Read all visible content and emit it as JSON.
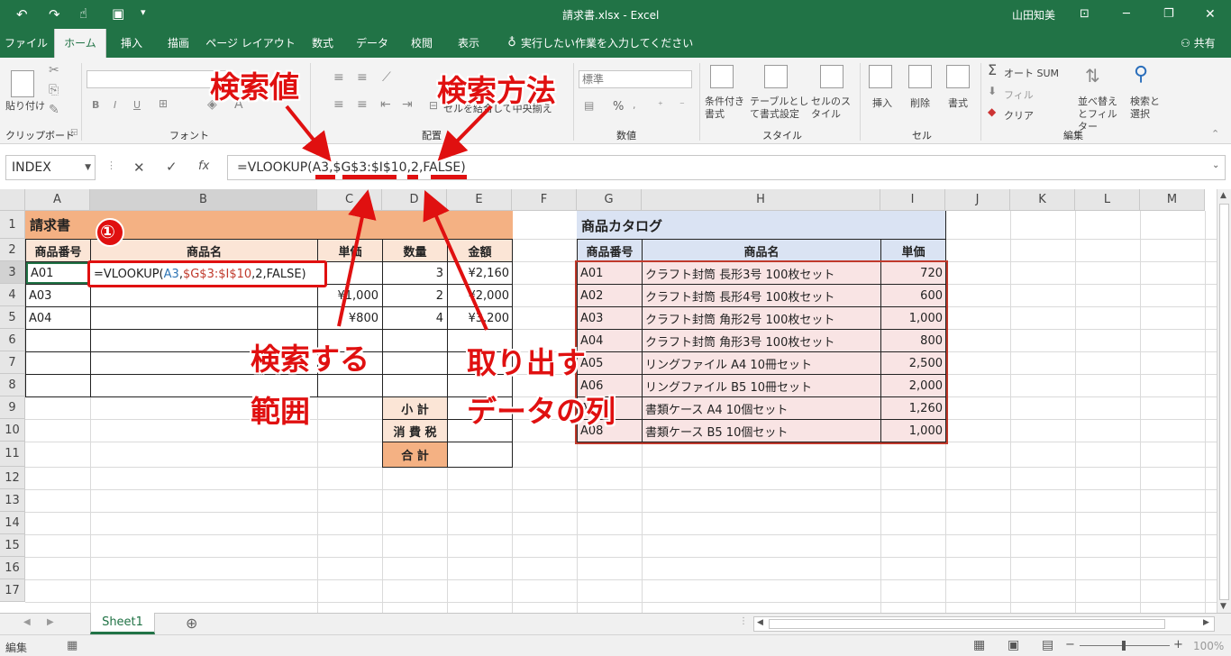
{
  "title_bar": {
    "document_title": "請求書.xlsx  -  Excel",
    "user_name": "山田知美"
  },
  "tabs": [
    "ファイル",
    "ホーム",
    "挿入",
    "描画",
    "ページ レイアウト",
    "数式",
    "データ",
    "校閲",
    "表示"
  ],
  "tell_me": "実行したい作業を入力してください",
  "share": "共有",
  "ribbon": {
    "clipboard": {
      "group": "クリップボード",
      "paste": "貼り付け"
    },
    "font": {
      "group": "フォント",
      "bold": "B",
      "italic": "I",
      "underline": "U"
    },
    "alignment": {
      "group": "配置",
      "merge": "セルを結合して中央揃え"
    },
    "number": {
      "group": "数値",
      "format": "標準",
      "percent": "%"
    },
    "styles": {
      "group": "スタイル",
      "conditional": "条件付き書式",
      "table": "テーブルとして書式設定",
      "cell_styles": "セルのスタイル"
    },
    "cells": {
      "group": "セル",
      "insert": "挿入",
      "delete": "削除",
      "format": "書式"
    },
    "editing": {
      "group": "編集",
      "autosum": "オート SUM",
      "fill": "フィル",
      "clear": "クリア",
      "sort": "並べ替えとフィルター",
      "find": "検索と選択"
    }
  },
  "formula_bar": {
    "name_box": "INDEX",
    "formula": "=VLOOKUP(A3,$G$3:$I$10,2,FALSE)",
    "fx": "fx"
  },
  "columns": [
    "A",
    "B",
    "C",
    "D",
    "E",
    "F",
    "G",
    "H",
    "I",
    "J",
    "K",
    "L",
    "M"
  ],
  "rows": [
    "1",
    "2",
    "3",
    "4",
    "5",
    "6",
    "7",
    "8",
    "9",
    "10",
    "11",
    "12",
    "13",
    "14",
    "15",
    "16",
    "17"
  ],
  "invoice": {
    "title": "請求書",
    "headers": [
      "商品番号",
      "商品名",
      "単価",
      "数量",
      "金額"
    ],
    "rows": [
      {
        "code": "A01",
        "name": "",
        "price": "",
        "qty": "3",
        "amount": "¥2,160"
      },
      {
        "code": "A03",
        "name": "",
        "price": "¥1,000",
        "qty": "2",
        "amount": "¥2,000"
      },
      {
        "code": "A04",
        "name": "",
        "price": "¥800",
        "qty": "4",
        "amount": "¥3,200"
      }
    ],
    "subtotal": "小 計",
    "tax": "消 費 税",
    "total": "合 計",
    "formula_in_cell": {
      "p0": "=VLOOKUP(",
      "p1": "A3",
      "p2": ",",
      "p3": "$G$3:$I$10",
      "p4": ",2,FALSE)"
    }
  },
  "catalog": {
    "title": "商品カタログ",
    "headers": [
      "商品番号",
      "商品名",
      "単価"
    ],
    "rows": [
      {
        "code": "A01",
        "name": "クラフト封筒 長形3号 100枚セット",
        "price": "720"
      },
      {
        "code": "A02",
        "name": "クラフト封筒 長形4号 100枚セット",
        "price": "600"
      },
      {
        "code": "A03",
        "name": "クラフト封筒 角形2号 100枚セット",
        "price": "1,000"
      },
      {
        "code": "A04",
        "name": "クラフト封筒 角形3号 100枚セット",
        "price": "800"
      },
      {
        "code": "A05",
        "name": "リングファイル A4 10冊セット",
        "price": "2,500"
      },
      {
        "code": "A06",
        "name": "リングファイル B5 10冊セット",
        "price": "2,000"
      },
      {
        "code": "A07",
        "name": "書類ケース A4 10個セット",
        "price": "1,260"
      },
      {
        "code": "A08",
        "name": "書類ケース B5 10個セット",
        "price": "1,000"
      }
    ]
  },
  "annotations": {
    "lookup_value": "検索値",
    "match_type": "検索方法",
    "range_line1": "検索する",
    "range_line2": "範囲",
    "col_line1": "取り出す",
    "col_line2": "データの列",
    "step": "①"
  },
  "sheet_tab": "Sheet1",
  "status": {
    "mode": "編集",
    "zoom": "100%"
  },
  "colors": {
    "excel_green": "#217346",
    "invoice_header": "#f4b183",
    "catalog_header": "#dae3f3",
    "catalog_body": "#f9e4e4",
    "annotation_red": "#e01010"
  }
}
